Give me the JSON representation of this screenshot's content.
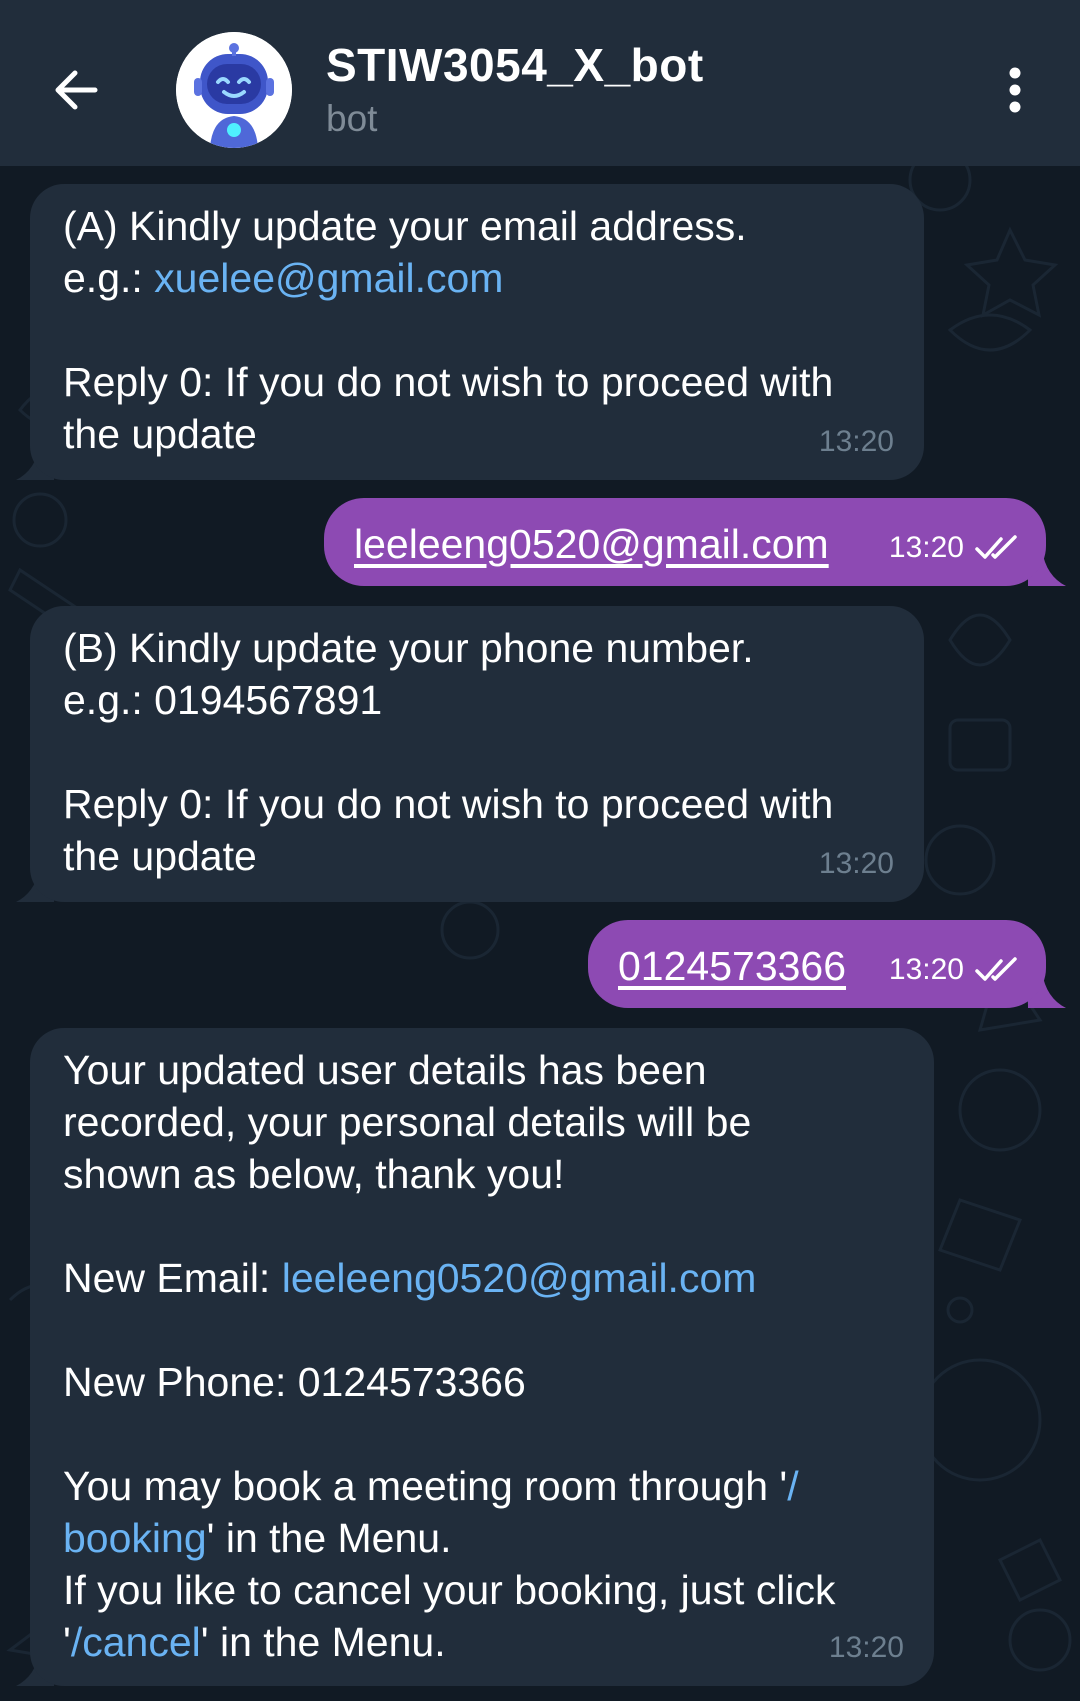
{
  "header": {
    "title": "STIW3054_X_bot",
    "subtitle": "bot",
    "back_icon": "arrow-left-icon",
    "menu_icon": "more-vertical-icon",
    "avatar_icon": "robot-avatar"
  },
  "colors": {
    "header_bg": "#212d3b",
    "chat_bg": "#0e1621",
    "incoming_bubble": "#212d3b",
    "outgoing_bubble": "#8d4ab3",
    "link": "#6ab3f3",
    "timestamp_in": "#6d7f8f"
  },
  "messages": [
    {
      "direction": "in",
      "lines": [
        "(A) Kindly update your email address."
      ],
      "example_prefix": "e.g.: ",
      "example_link": "xuelee@gmail.com",
      "reply_lines": [
        "Reply 0: If you do not wish to proceed with",
        "the update"
      ],
      "time": "13:20"
    },
    {
      "direction": "out",
      "text": "leeleeng0520@gmail.com",
      "time": "13:20",
      "status_icon": "double-check-icon"
    },
    {
      "direction": "in",
      "lines": [
        "(B) Kindly update your phone number.",
        "e.g.: 0194567891"
      ],
      "reply_lines": [
        "Reply 0: If you do not wish to proceed with",
        "the update"
      ],
      "time": "13:20"
    },
    {
      "direction": "out",
      "text": "0124573366",
      "time": "13:20",
      "status_icon": "double-check-icon"
    },
    {
      "direction": "in",
      "intro_lines": [
        "Your updated user details has been",
        "recorded, your personal details will be",
        "shown as below, thank you!"
      ],
      "email_label": "New Email: ",
      "email_link": "leeleeng0520@gmail.com",
      "phone_line": "New Phone: 0124573366",
      "booking_pre": "You may book a meeting room through '",
      "booking_link_1": "/",
      "booking_link_2": "booking",
      "booking_post": "' in the Menu.",
      "cancel_line": "If you like to cancel your booking, just click",
      "cancel_quote_open": "'",
      "cancel_link": "/cancel",
      "cancel_post": "' in the Menu.",
      "time": "13:20"
    }
  ]
}
